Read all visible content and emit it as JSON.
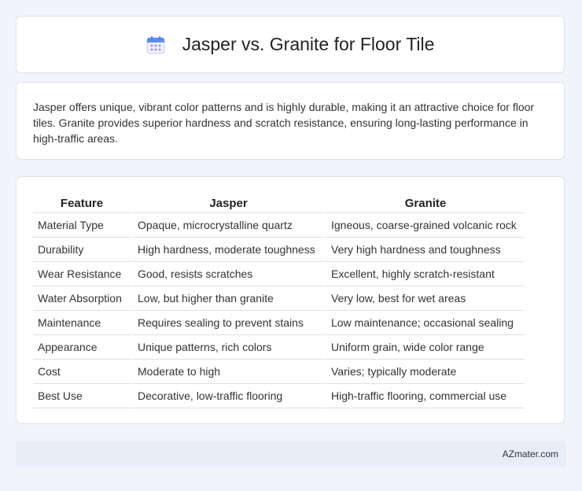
{
  "header": {
    "title": "Jasper vs. Granite for Floor Tile",
    "icon": "calendar-icon"
  },
  "summary": {
    "text": "Jasper offers unique, vibrant color patterns and is highly durable, making it an attractive choice for floor tiles. Granite provides superior hardness and scratch resistance, ensuring long-lasting performance in high-traffic areas."
  },
  "table": {
    "headers": [
      "Feature",
      "Jasper",
      "Granite"
    ],
    "rows": [
      [
        "Material Type",
        "Opaque, microcrystalline quartz",
        "Igneous, coarse-grained volcanic rock"
      ],
      [
        "Durability",
        "High hardness, moderate toughness",
        "Very high hardness and toughness"
      ],
      [
        "Wear Resistance",
        "Good, resists scratches",
        "Excellent, highly scratch-resistant"
      ],
      [
        "Water Absorption",
        "Low, but higher than granite",
        "Very low, best for wet areas"
      ],
      [
        "Maintenance",
        "Requires sealing to prevent stains",
        "Low maintenance; occasional sealing"
      ],
      [
        "Appearance",
        "Unique patterns, rich colors",
        "Uniform grain, wide color range"
      ],
      [
        "Cost",
        "Moderate to high",
        "Varies; typically moderate"
      ],
      [
        "Best Use",
        "Decorative, low-traffic flooring",
        "High-traffic flooring, commercial use"
      ]
    ]
  },
  "footer": {
    "brand": "AZmater.com"
  }
}
